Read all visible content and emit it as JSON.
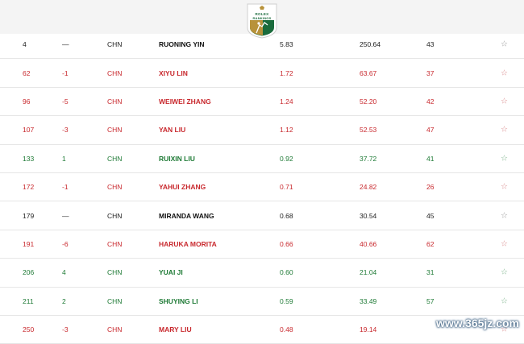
{
  "header": {
    "logo_line1": "ROLEX",
    "logo_line2": "RANKINGS"
  },
  "rankings": [
    {
      "rank": "4",
      "move": "—",
      "nat": "CHN",
      "name": "RUONING YIN",
      "avg": "5.83",
      "total": "250.64",
      "events": "43",
      "trend": "neutral"
    },
    {
      "rank": "62",
      "move": "-1",
      "nat": "CHN",
      "name": "XIYU LIN",
      "avg": "1.72",
      "total": "63.67",
      "events": "37",
      "trend": "down"
    },
    {
      "rank": "96",
      "move": "-5",
      "nat": "CHN",
      "name": "WEIWEI ZHANG",
      "avg": "1.24",
      "total": "52.20",
      "events": "42",
      "trend": "down"
    },
    {
      "rank": "107",
      "move": "-3",
      "nat": "CHN",
      "name": "YAN LIU",
      "avg": "1.12",
      "total": "52.53",
      "events": "47",
      "trend": "down"
    },
    {
      "rank": "133",
      "move": "1",
      "nat": "CHN",
      "name": "RUIXIN LIU",
      "avg": "0.92",
      "total": "37.72",
      "events": "41",
      "trend": "up"
    },
    {
      "rank": "172",
      "move": "-1",
      "nat": "CHN",
      "name": "YAHUI ZHANG",
      "avg": "0.71",
      "total": "24.82",
      "events": "26",
      "trend": "down"
    },
    {
      "rank": "179",
      "move": "—",
      "nat": "CHN",
      "name": "MIRANDA WANG",
      "avg": "0.68",
      "total": "30.54",
      "events": "45",
      "trend": "neutral"
    },
    {
      "rank": "191",
      "move": "-6",
      "nat": "CHN",
      "name": "HARUKA MORITA",
      "avg": "0.66",
      "total": "40.66",
      "events": "62",
      "trend": "down"
    },
    {
      "rank": "206",
      "move": "4",
      "nat": "CHN",
      "name": "YUAI JI",
      "avg": "0.60",
      "total": "21.04",
      "events": "31",
      "trend": "up"
    },
    {
      "rank": "211",
      "move": "2",
      "nat": "CHN",
      "name": "SHUYING LI",
      "avg": "0.59",
      "total": "33.49",
      "events": "57",
      "trend": "up"
    },
    {
      "rank": "250",
      "move": "-3",
      "nat": "CHN",
      "name": "MARY LIU",
      "avg": "0.48",
      "total": "19.14",
      "events": "",
      "trend": "down"
    }
  ],
  "star_glyph": "☆",
  "watermark": "www.365jz.com",
  "colors": {
    "up": "#1e7a35",
    "down": "#c8282d",
    "neutral": "#222222",
    "logo_green": "#1a6b3c",
    "logo_gold": "#b8923a"
  }
}
